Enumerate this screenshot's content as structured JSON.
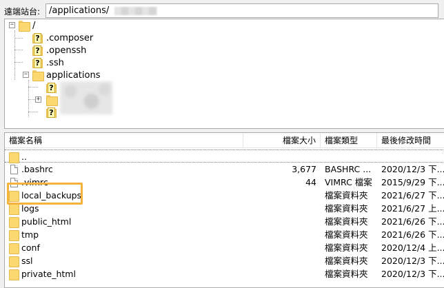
{
  "pathbar": {
    "label": "遠端站台:",
    "path": "/applications/"
  },
  "tree": {
    "root": "/",
    "items": [
      {
        "name": ".composer"
      },
      {
        "name": ".openssh"
      },
      {
        "name": ".ssh"
      },
      {
        "name": "applications"
      }
    ],
    "expanders": {
      "root": "−",
      "applications": "−",
      "sub": "+"
    }
  },
  "list": {
    "columns": {
      "name": "檔案名稱",
      "size": "檔案大小",
      "type": "檔案類型",
      "date": "最後修改時間"
    },
    "parent": "..",
    "rows": [
      {
        "name": ".bashrc",
        "kind": "file",
        "size": "3,677",
        "type": "BASHRC ...",
        "date": "2020/12/3 下..."
      },
      {
        "name": ".vimrc",
        "kind": "file",
        "size": "44",
        "type": "VIMRC 檔案",
        "date": "2015/9/29 下..."
      },
      {
        "name": "local_backups",
        "kind": "folder",
        "size": "",
        "type": "檔案資料夾",
        "date": "2021/6/27 下..."
      },
      {
        "name": "logs",
        "kind": "folder",
        "size": "",
        "type": "檔案資料夾",
        "date": "2021/6/27 上..."
      },
      {
        "name": "public_html",
        "kind": "folder",
        "size": "",
        "type": "檔案資料夾",
        "date": "2021/6/26 下..."
      },
      {
        "name": "tmp",
        "kind": "folder",
        "size": "",
        "type": "檔案資料夾",
        "date": "2021/6/26 下..."
      },
      {
        "name": "conf",
        "kind": "folder",
        "size": "",
        "type": "檔案資料夾",
        "date": "2020/12/4 上..."
      },
      {
        "name": "ssl",
        "kind": "folder",
        "size": "",
        "type": "檔案資料夾",
        "date": "2020/12/3 下..."
      },
      {
        "name": "private_html",
        "kind": "folder",
        "size": "",
        "type": "檔案資料夾",
        "date": "2020/12/3 下..."
      }
    ]
  },
  "colors": {
    "highlight": "#f7b23b",
    "folder": "#fcd870"
  }
}
